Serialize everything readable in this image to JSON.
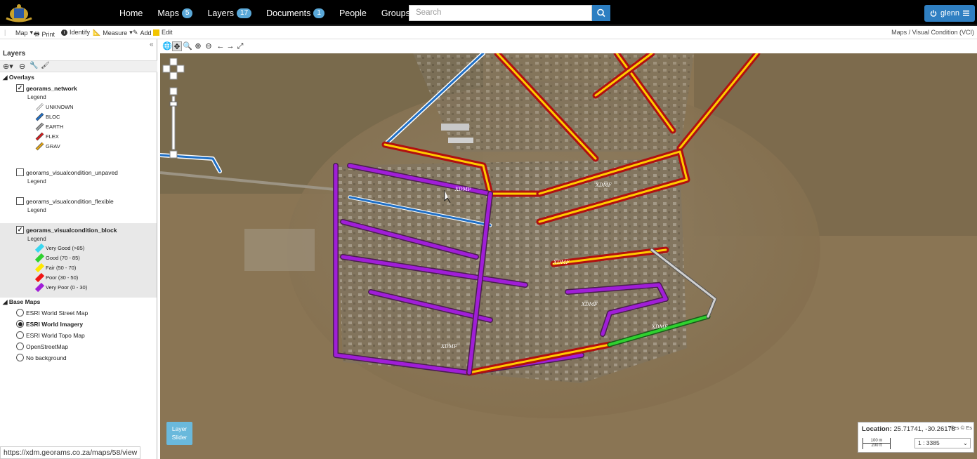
{
  "nav": {
    "items": [
      {
        "label": "Home",
        "badge": ""
      },
      {
        "label": "Maps",
        "badge": "5"
      },
      {
        "label": "Layers",
        "badge": "17"
      },
      {
        "label": "Documents",
        "badge": "1"
      },
      {
        "label": "People",
        "badge": ""
      },
      {
        "label": "Groups",
        "badge": ""
      }
    ],
    "search_placeholder": "Search",
    "user": "glenn"
  },
  "toolbar": {
    "map": "Map",
    "print": "Print",
    "identify": "Identify",
    "measure": "Measure",
    "add": "Add",
    "edit": "Edit",
    "breadcrumb": "Maps / Visual Condition (VCI)"
  },
  "panel": {
    "title": "Layers",
    "overlays_label": "Overlays",
    "base_maps_label": "Base Maps",
    "legend_word": "Legend",
    "layers": [
      {
        "name": "georams_network",
        "checked": true,
        "bold": true
      },
      {
        "name": "georams_visualcondition_unpaved",
        "checked": false,
        "bold": false
      },
      {
        "name": "georams_visualcondition_flexible",
        "checked": false,
        "bold": false
      },
      {
        "name": "georams_visualcondition_block",
        "checked": true,
        "bold": true
      }
    ],
    "network_legend": [
      {
        "label": "UNKNOWN",
        "color": "#ffffff"
      },
      {
        "label": "BLOC",
        "color": "#1f6fc5"
      },
      {
        "label": "EARTH",
        "color": "#9e9e9e"
      },
      {
        "label": "FLEX",
        "color": "#d91e1e"
      },
      {
        "label": "GRAV",
        "color": "#e8a917"
      }
    ],
    "block_legend": [
      {
        "label": "Very Good (>85)",
        "color": "#3ad7ef"
      },
      {
        "label": "Good (70 - 85)",
        "color": "#2fd12f"
      },
      {
        "label": "Fair (50 - 70)",
        "color": "#ffe800"
      },
      {
        "label": "Poor (30 - 50)",
        "color": "#f01414"
      },
      {
        "label": "Very Poor (0 - 30)",
        "color": "#a01ed8"
      }
    ],
    "base_maps": [
      {
        "label": "ESRI World Street Map",
        "selected": false
      },
      {
        "label": "ESRI World Imagery",
        "selected": true
      },
      {
        "label": "ESRI World Topo Map",
        "selected": false
      },
      {
        "label": "OpenStreetMap",
        "selected": false
      },
      {
        "label": "No background",
        "selected": false
      }
    ]
  },
  "map": {
    "layer_slider": [
      "Layer",
      "Slider"
    ],
    "location_label": "Location:",
    "location_value": "25.71741, -30.26178",
    "attribution": "Tiles © Es",
    "scale_m": "100 m",
    "scale_ft": "200 ft",
    "scale_ratio": "1 : 3385",
    "street_label": "XDMF",
    "status_url": "https://xdm.georams.co.za/maps/58/view"
  }
}
